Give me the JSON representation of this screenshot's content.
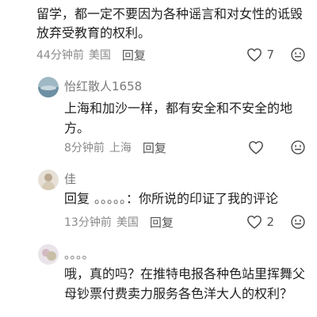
{
  "partial_comment": {
    "text": "留学，都一定不要因为各种谣言和对女性的诋毁放弃受教育的权利。",
    "time": "44分钟前",
    "location": "美国",
    "reply_label": "回复",
    "like_count": "7"
  },
  "comments": [
    {
      "username": "怡红散人1658",
      "text": "上海和加沙一样，都有安全和不安全的地方。",
      "time": "8分钟前",
      "location": "上海",
      "reply_label": "回复",
      "like_count": ""
    },
    {
      "username": "佳",
      "reply_prefix": "回复",
      "reply_target": "。。。。。",
      "reply_colon": "：",
      "text": "你所说的印证了我的评论",
      "time": "13分钟前",
      "location": "美国",
      "reply_label": "回复",
      "like_count": "2"
    },
    {
      "username": "。。。。",
      "text": "哦，真的吗？在推特电报各种色站里挥舞父母钞票付费卖力服务各色洋大人的权利？"
    }
  ],
  "icons": {
    "like": "heart-outline-icon",
    "emoji": "smiley-face-icon"
  },
  "colors": {
    "meta_gray": "#8a8a8a",
    "text": "#1f1f1f",
    "icon_stroke": "#4a4a4a"
  }
}
